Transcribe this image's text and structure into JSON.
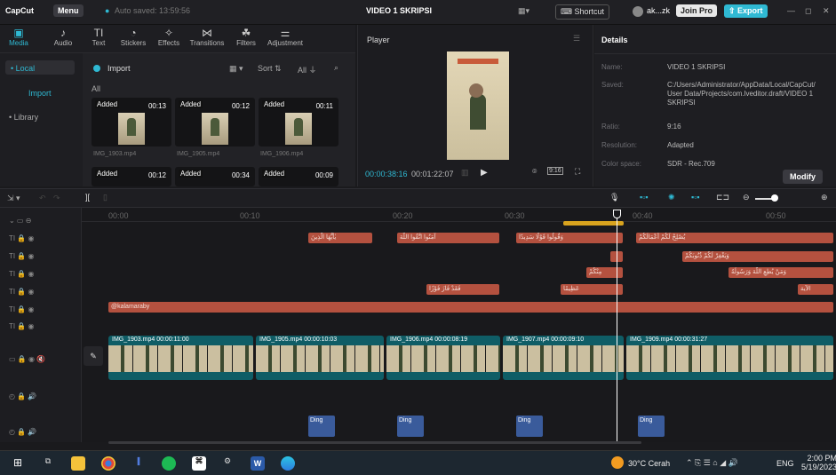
{
  "titlebar": {
    "logo": "CapCut",
    "menu": "Menu",
    "autosave": "Auto saved: 13:59:56",
    "project": "VIDEO 1 SKRIPSI",
    "shortcut": "Shortcut",
    "user": "ak...zk",
    "join": "Join Pro",
    "export": "Export"
  },
  "toolbar": {
    "items": [
      {
        "label": "Media",
        "icon": "media-icon"
      },
      {
        "label": "Audio",
        "icon": "audio-icon"
      },
      {
        "label": "Text",
        "icon": "text-icon"
      },
      {
        "label": "Stickers",
        "icon": "sticker-icon"
      },
      {
        "label": "Effects",
        "icon": "effects-icon"
      },
      {
        "label": "Transitions",
        "icon": "transitions-icon"
      },
      {
        "label": "Filters",
        "icon": "filters-icon"
      },
      {
        "label": "Adjustment",
        "icon": "adjustment-icon"
      }
    ]
  },
  "leftnav": {
    "local": "• Local",
    "import": "Import",
    "library": "• Library"
  },
  "media": {
    "import": "Import",
    "sort": "Sort",
    "all": "All",
    "filter_all": "All",
    "thumbs": [
      {
        "added": "Added",
        "dur": "00:13",
        "name": "IMG_1903.mp4"
      },
      {
        "added": "Added",
        "dur": "00:12",
        "name": "IMG_1905.mp4"
      },
      {
        "added": "Added",
        "dur": "00:11",
        "name": "IMG_1906.mp4"
      },
      {
        "added": "Added",
        "dur": "00:12",
        "name": ""
      },
      {
        "added": "Added",
        "dur": "00:34",
        "name": ""
      },
      {
        "added": "Added",
        "dur": "00:09",
        "name": ""
      }
    ]
  },
  "player": {
    "title": "Player",
    "current": "00:00:38:16",
    "total": "00:01:22:07",
    "ratio": "9:16"
  },
  "details": {
    "title": "Details",
    "rows": [
      {
        "label": "Name:",
        "value": "VIDEO 1 SKRIPSI"
      },
      {
        "label": "Saved:",
        "value": "C:/Users/Administrator/AppData/Local/CapCut/User Data/Projects/com.lveditor.draft/VIDEO 1 SKRIPSI"
      },
      {
        "label": "Ratio:",
        "value": "9:16"
      },
      {
        "label": "Resolution:",
        "value": "Adapted"
      },
      {
        "label": "Color space:",
        "value": "SDR - Rec.709"
      }
    ],
    "modify": "Modify"
  },
  "ruler": [
    "00:00",
    "00:10",
    "00:20",
    "00:30",
    "00:40",
    "00:50"
  ],
  "timeline": {
    "text_track_label": "TI",
    "caption_clip": "@kalamaraby",
    "video_clips": [
      {
        "label": "IMG_1903.mp4  00:00:11:00"
      },
      {
        "label": "IMG_1905.mp4  00:00:10:03"
      },
      {
        "label": "IMG_1906.mp4  00:00:08:19"
      },
      {
        "label": "IMG_1907.mp4  00:00:09:10"
      },
      {
        "label": "IMG_1909.mp4  00:00:31:27"
      }
    ],
    "audio_clip": "Ding"
  },
  "taskbar": {
    "weather": "30°C Cerah",
    "lang": "ENG",
    "time": "2:00 PM",
    "date": "5/19/2023"
  },
  "colors": {
    "accent": "#2fb9d3",
    "text_clip": "#b4513f",
    "video_clip": "#0f5d66",
    "audio_clip": "#3a5b9b"
  }
}
